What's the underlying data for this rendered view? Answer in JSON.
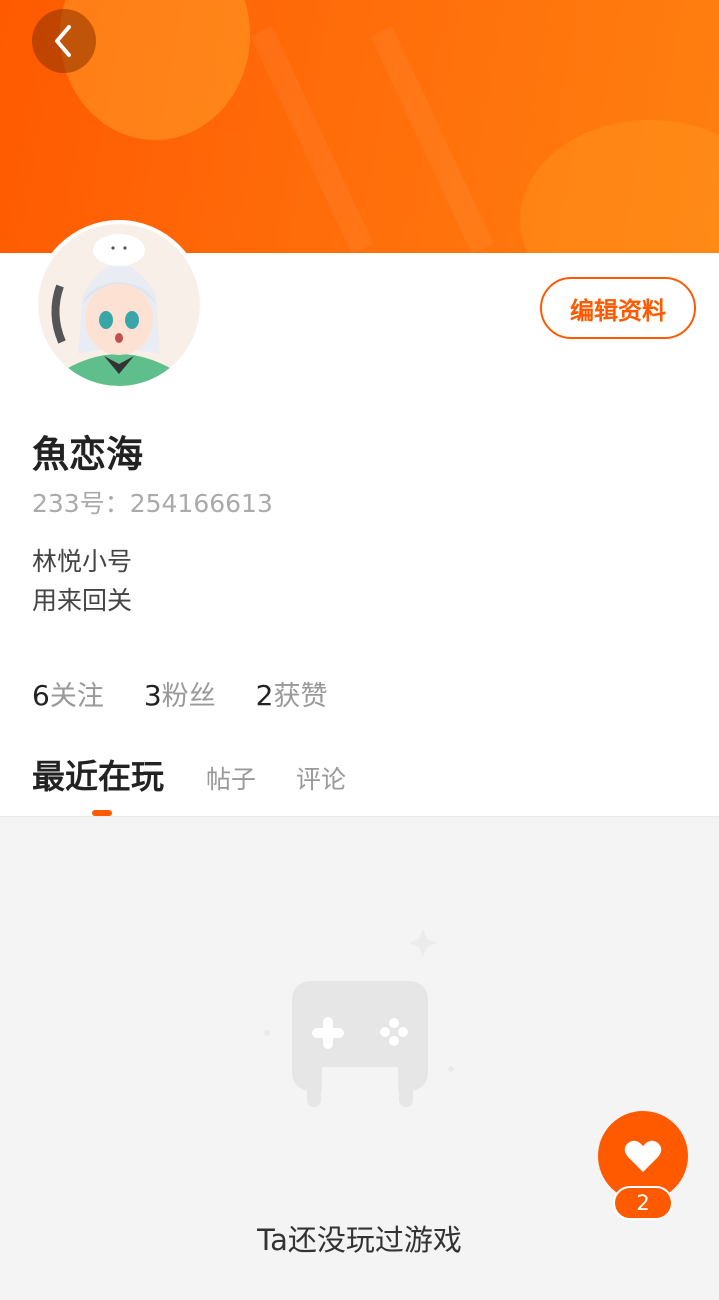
{
  "profile": {
    "nickname": "魚恋海",
    "user_id_label": "233号：254166613",
    "bio_lines": [
      "林悦小号",
      "用来回关"
    ],
    "edit_label": "编辑资料"
  },
  "stats": [
    {
      "count": "6",
      "label": "关注"
    },
    {
      "count": "3",
      "label": "粉丝"
    },
    {
      "count": "2",
      "label": "获赞"
    }
  ],
  "tabs": [
    {
      "label": "最近在玩",
      "active": true
    },
    {
      "label": "帖子",
      "active": false
    },
    {
      "label": "评论",
      "active": false
    }
  ],
  "empty_state": {
    "message": "Ta还没玩过游戏",
    "icon": "gamepad-icon"
  },
  "fab": {
    "icon": "heart-icon",
    "badge": "2"
  },
  "icons": {
    "back": "chevron-left-icon"
  },
  "colors": {
    "accent": "#ff5a00",
    "banner_start": "#ff5a00",
    "banner_end": "#ff7f10",
    "muted_text": "#999999",
    "content_bg": "#f4f4f4"
  }
}
